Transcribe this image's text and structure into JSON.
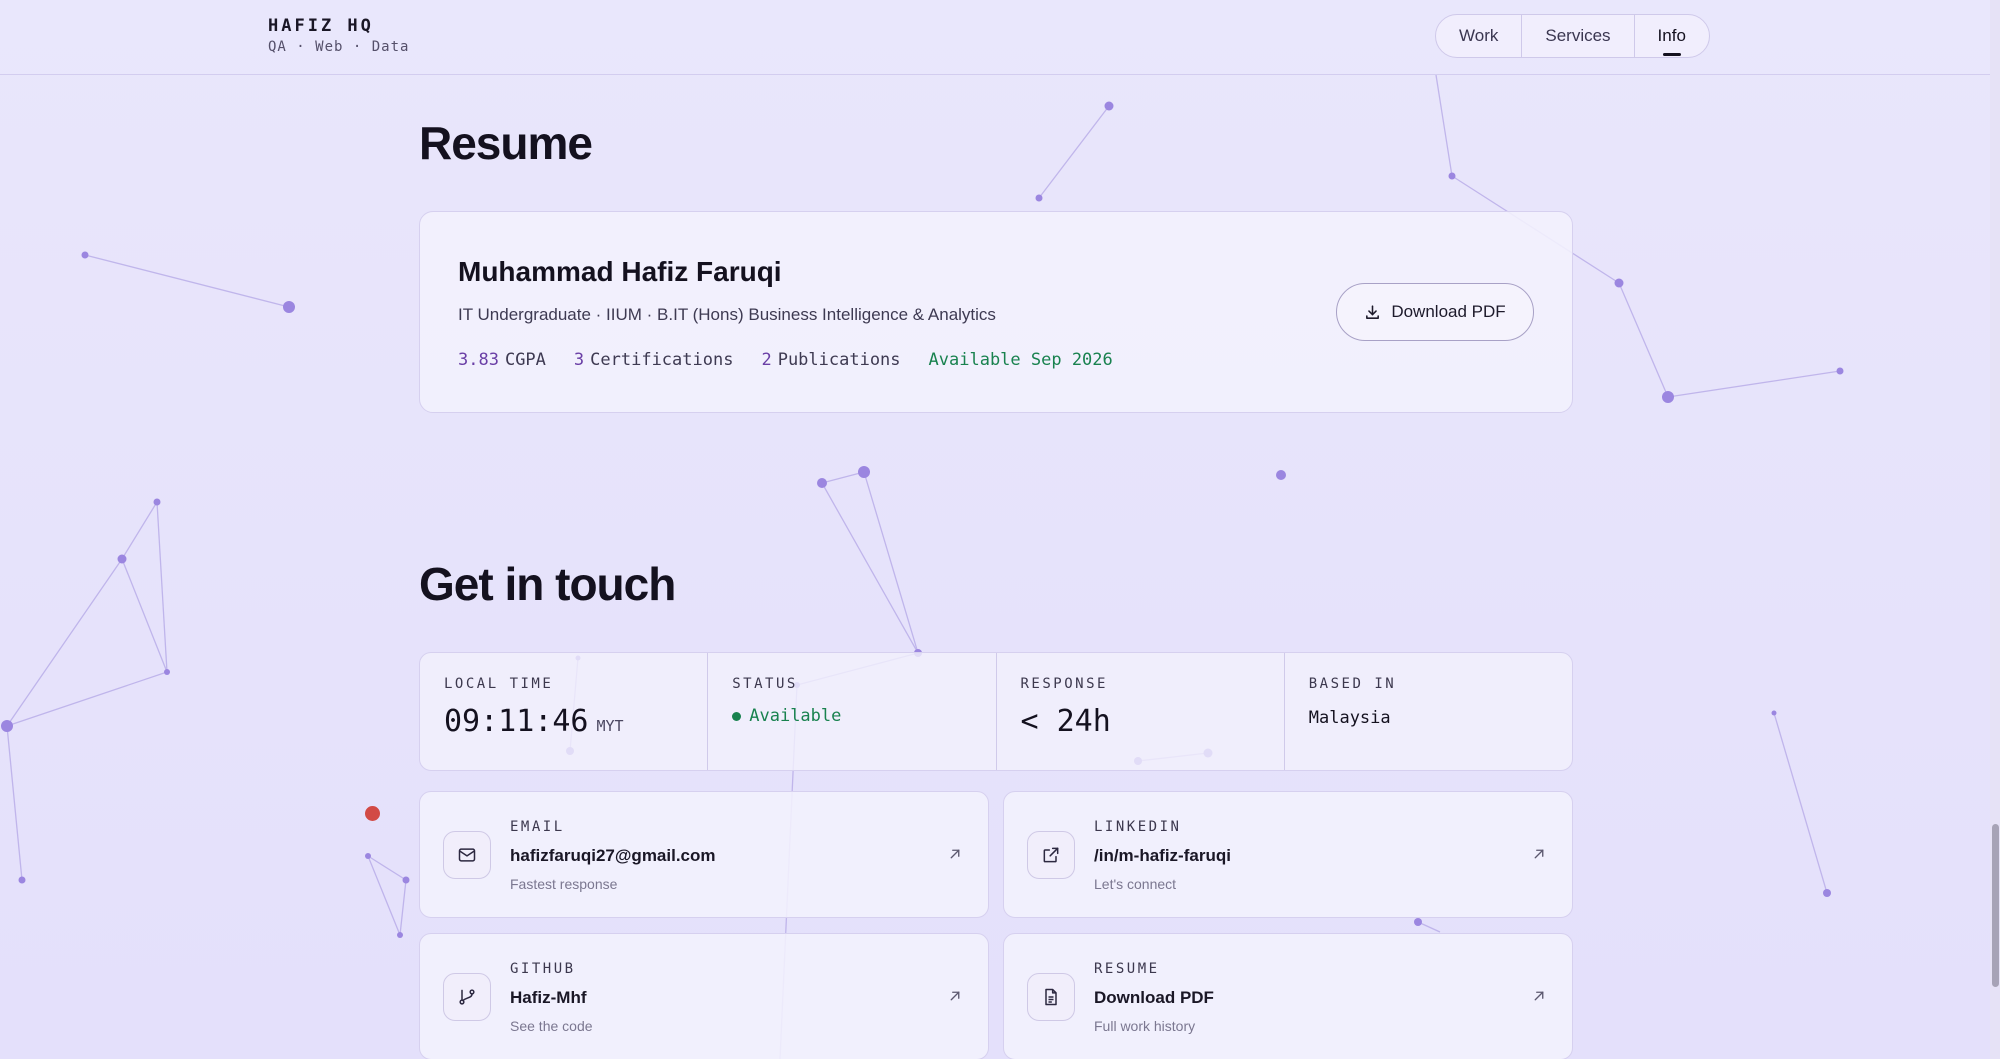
{
  "header": {
    "brand_name": "HAFIZ HQ",
    "brand_tagline": "QA · Web · Data",
    "nav": [
      {
        "label": "Work",
        "active": false
      },
      {
        "label": "Services",
        "active": false
      },
      {
        "label": "Info",
        "active": true
      }
    ]
  },
  "resume": {
    "heading": "Resume",
    "name": "Muhammad Hafiz Faruqi",
    "subtitle": "IT Undergraduate · IIUM · B.IT (Hons) Business Intelligence & Analytics",
    "stats": {
      "cgpa_value": "3.83",
      "cgpa_label": "CGPA",
      "cert_value": "3",
      "cert_label": "Certifications",
      "pub_value": "2",
      "pub_label": "Publications",
      "availability": "Available Sep 2026"
    },
    "download_label": "Download PDF"
  },
  "contact": {
    "heading": "Get in touch",
    "strip": {
      "local_time_label": "LOCAL TIME",
      "local_time_value": "09:11:46",
      "local_time_zone": "MYT",
      "status_label": "STATUS",
      "status_value": "Available",
      "response_label": "RESPONSE",
      "response_value": "< 24h",
      "based_label": "BASED IN",
      "based_value": "Malaysia"
    },
    "cards": {
      "email": {
        "label": "EMAIL",
        "value": "hafizfaruqi27@gmail.com",
        "note": "Fastest response"
      },
      "linkedin": {
        "label": "LINKEDIN",
        "value": "/in/m-hafiz-faruqi",
        "note": "Let's connect"
      },
      "github": {
        "label": "GITHUB",
        "value": "Hafiz-Mhf",
        "note": "See the code"
      },
      "resume": {
        "label": "RESUME",
        "value": "Download PDF",
        "note": "Full work history"
      }
    }
  },
  "colors": {
    "background": "#e6e2fb",
    "accent_purple": "#6a3fa6",
    "status_green": "#19824f",
    "network_node": "#9b86e0"
  },
  "icons": [
    "download-icon",
    "mail-icon",
    "external-link-icon",
    "git-branch-icon",
    "file-text-icon",
    "arrow-up-right-icon"
  ]
}
